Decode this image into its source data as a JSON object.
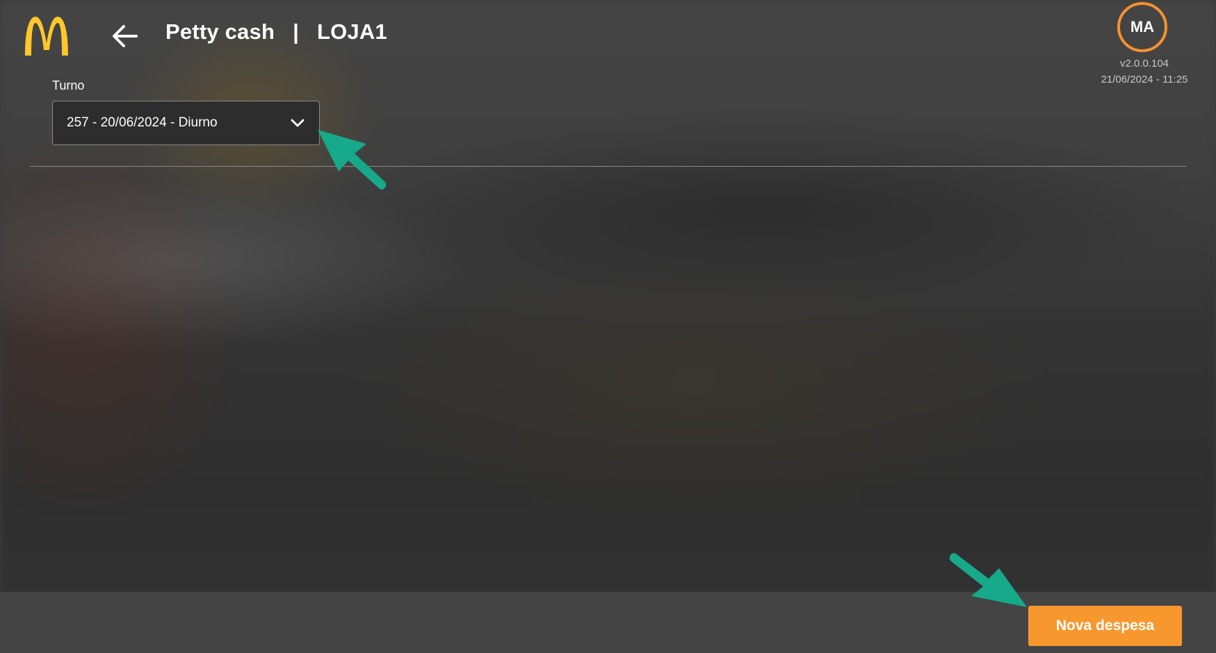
{
  "header": {
    "logo_icon": "mcdonalds-golden-arches-icon",
    "back_icon": "arrow-left-icon",
    "page_title": "Petty cash",
    "separator": "|",
    "store_name": "LOJA1"
  },
  "user": {
    "initials": "MA",
    "version": "v2.0.0.104",
    "datetime": "21/06/2024 - 11:25"
  },
  "filters": {
    "shift_label": "Turno",
    "shift_selected": "257 - 20/06/2024 - Diurno",
    "shift_dropdown_icon": "chevron-down-icon"
  },
  "footer": {
    "new_expense_label": "Nova despesa"
  },
  "annotations": {
    "arrow_icon": "callout-arrow-icon",
    "arrow_color": "#16a98a"
  },
  "colors": {
    "brand_yellow": "#ffc72c",
    "accent_orange": "#f7982f",
    "avatar_ring": "#f7922f"
  }
}
